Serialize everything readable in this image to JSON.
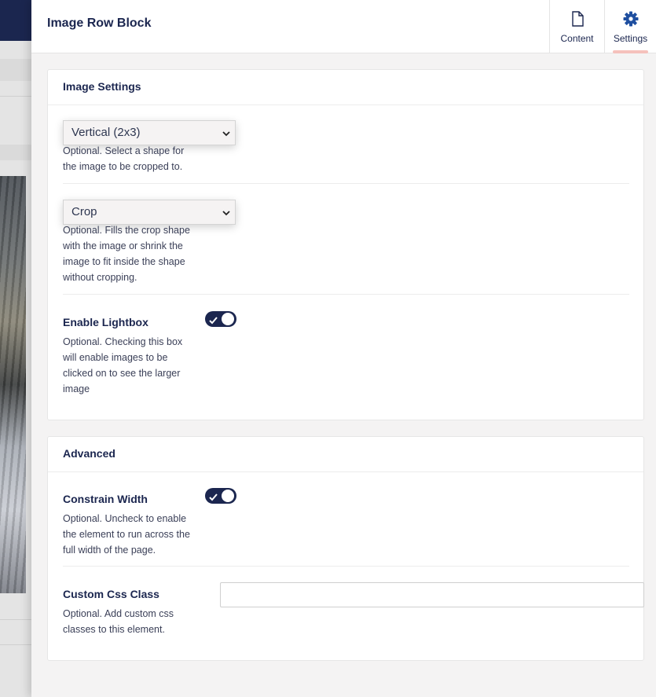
{
  "header": {
    "title": "Image Row Block",
    "tabs": [
      {
        "label": "Content",
        "icon": "document-icon"
      },
      {
        "label": "Settings",
        "icon": "gear-icon",
        "active": true
      }
    ]
  },
  "image_settings": {
    "title": "Image Settings",
    "crop_shape": {
      "value": "Vertical (2x3)",
      "description": "Optional. Select a shape for the image to be cropped to."
    },
    "crop_mode": {
      "value": "Crop",
      "description": "Optional. Fills the crop shape with the image or shrink the image to fit inside the shape without cropping."
    },
    "lightbox": {
      "label": "Enable Lightbox",
      "checked": true,
      "description": "Optional. Checking this box will enable images to be clicked on to see the larger image"
    }
  },
  "advanced": {
    "title": "Advanced",
    "constrain_width": {
      "label": "Constrain Width",
      "checked": true,
      "description": "Optional. Uncheck to enable the element to run across the full width of the page."
    },
    "custom_css": {
      "label": "Custom Css Class",
      "value": "",
      "description": "Optional. Add custom css classes to this element."
    }
  },
  "colors": {
    "navy": "#1b264f",
    "tab_active_indicator": "#f5c1bc",
    "panel_bg": "#f4f3f3"
  }
}
